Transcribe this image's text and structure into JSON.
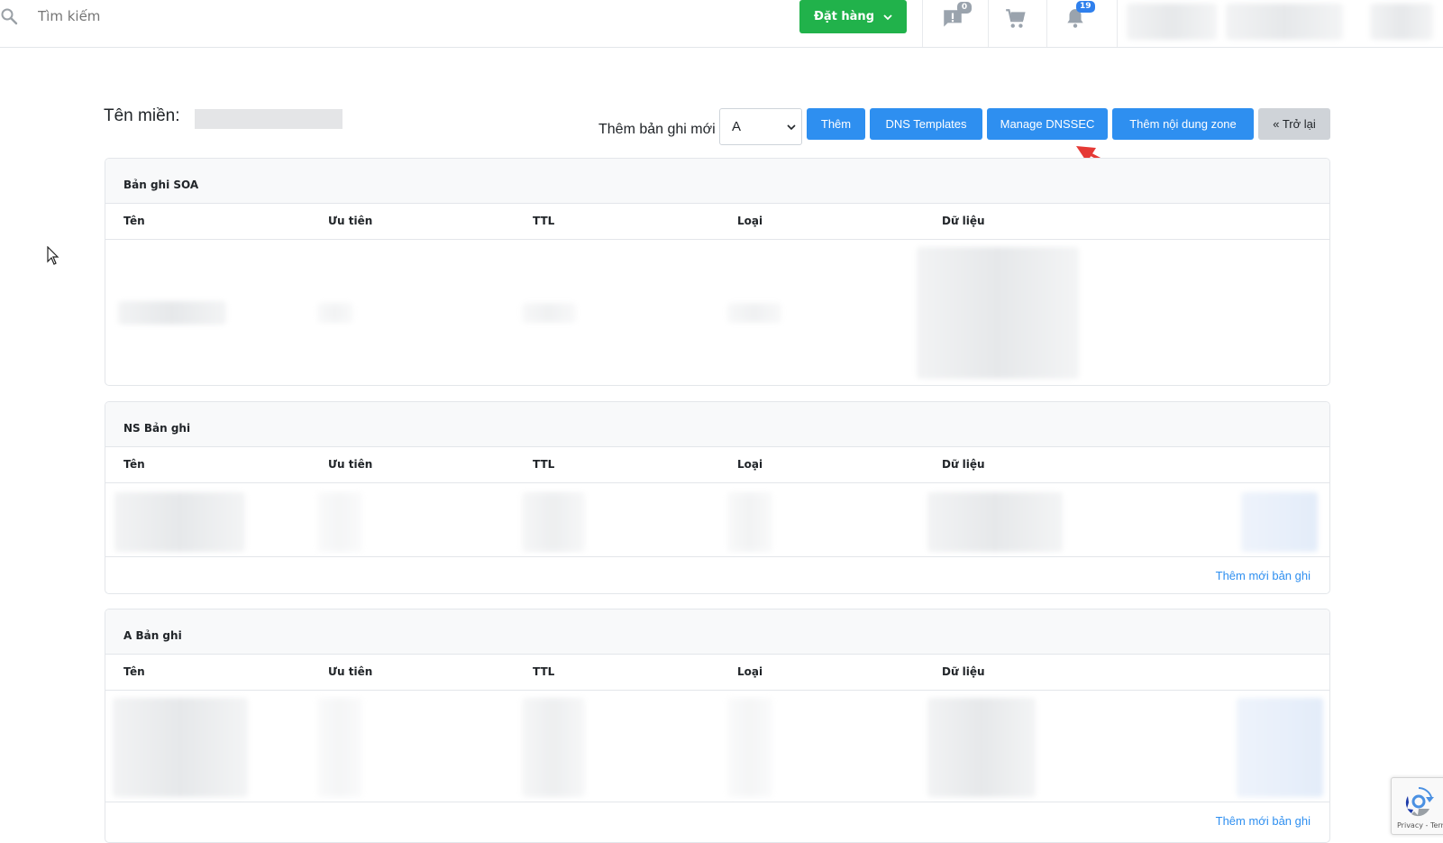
{
  "topbar": {
    "search_placeholder": "Tìm kiếm",
    "order_button": "Đặt hàng",
    "messages_count": "0",
    "notifications_count": "19"
  },
  "header": {
    "domain_label": "Tên miền:",
    "new_record_label": "Thêm bản ghi mới",
    "record_type_selected": "A",
    "buttons": {
      "add": "Thêm",
      "dns_templates": "DNS Templates",
      "manage_dnssec": "Manage DNSSEC",
      "add_zone_content": "Thêm nội dung zone",
      "back": "« Trở lại"
    }
  },
  "columns": [
    "Tên",
    "Ưu tiên",
    "TTL",
    "Loại",
    "Dữ liệu"
  ],
  "sections": {
    "soa": {
      "title": "Bản ghi SOA"
    },
    "ns": {
      "title": "NS Bản ghi",
      "add_link": "Thêm mới bản ghi"
    },
    "a": {
      "title": "A Bản ghi",
      "add_link": "Thêm mới bản ghi"
    }
  },
  "recaptcha": {
    "text": "Privacy - Terms"
  },
  "colors": {
    "primary": "#2e8ff0",
    "success": "#21b24b",
    "annotation_arrow": "#e53935"
  }
}
